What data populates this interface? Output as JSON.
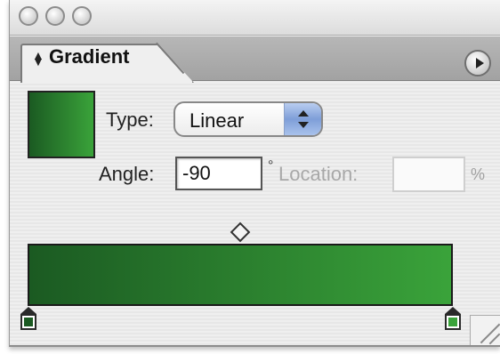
{
  "panel": {
    "tab_label": "Gradient",
    "type_label": "Type:",
    "type_value": "Linear",
    "angle_label": "Angle:",
    "angle_value": "-90",
    "degree_symbol": "°",
    "location_label": "Location:",
    "location_value": "",
    "percent_symbol": "%"
  },
  "gradient": {
    "start_color": "#1b5a22",
    "end_color": "#3aa33a",
    "stops": [
      {
        "position": 0,
        "color": "#1b5a22"
      },
      {
        "position": 1,
        "color": "#3aa33a"
      }
    ],
    "midpoint": 0.5
  },
  "icons": {
    "tab_arrows": "up-down-arrows-icon",
    "flyout": "play-right-icon",
    "resize": "resize-grip-icon"
  }
}
